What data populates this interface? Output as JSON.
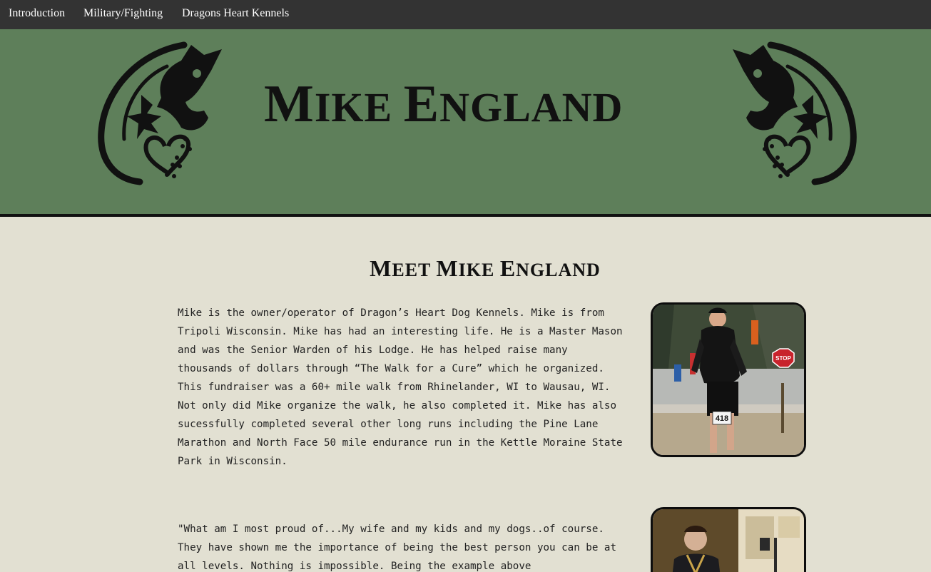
{
  "nav": {
    "items": [
      {
        "label": "Introduction"
      },
      {
        "label": "Military/Fighting"
      },
      {
        "label": "Dragons Heart Kennels"
      }
    ]
  },
  "banner": {
    "title_parts": [
      "M",
      "IKE ",
      "E",
      "NGLAND"
    ],
    "bg_color": "#5e7f5a",
    "logo_icon": "husky-dragon-heart-icon"
  },
  "section": {
    "title_parts": [
      "M",
      "EET ",
      "M",
      "IKE ",
      "E",
      "NGLAND"
    ],
    "paragraphs": [
      "   Mike is the owner/operator of Dragon’s Heart Dog Kennels. Mike is from Tripoli Wisconsin. Mike has had an interesting life. He is a Master Mason and was the Senior Warden of his Lodge. He has helped raise many thousands of dollars through “The Walk for a Cure” which he organized. This fundraiser was a 60+ mile walk from Rhinelander, WI to Wausau, WI. Not only did Mike organize the walk, he also completed it. Mike has also sucessfully completed several other long runs including the Pine Lane Marathon and North Face 50 mile endurance run in the Kettle Moraine State Park in Wisconsin.",
      "   \"What am I most proud of...My wife and my kids and my dogs..of course. They have shown me the importance of being the best person you can be at all levels. Nothing is impossible. Being the example above"
    ],
    "photo1": {
      "bib_number": "418",
      "sign_text": "STOP"
    }
  },
  "colors": {
    "nav_bg": "#333333",
    "page_bg": "#e2e0d2",
    "banner_bg": "#5e7f5a"
  }
}
